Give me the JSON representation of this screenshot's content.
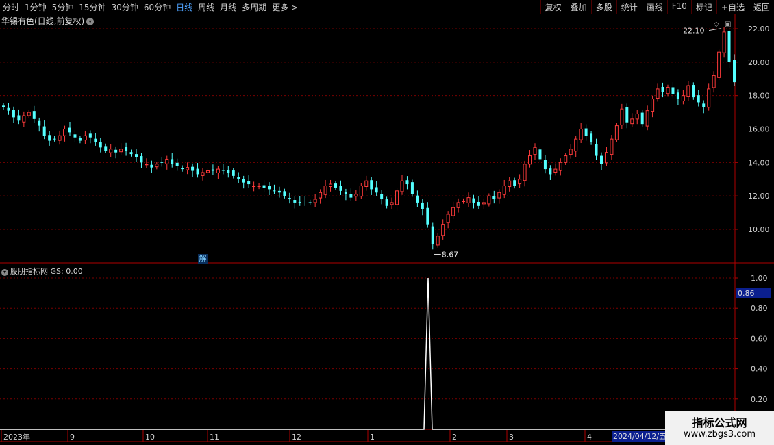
{
  "toolbar": {
    "periods": [
      "分时",
      "1分钟",
      "5分钟",
      "15分钟",
      "30分钟",
      "60分钟",
      "日线",
      "周线",
      "月线",
      "多周期",
      "更多 >"
    ],
    "active_period": "日线",
    "right_buttons": [
      "复权",
      "叠加",
      "多股",
      "统计",
      "画线",
      "F10",
      "标记",
      "+自选",
      "返回"
    ]
  },
  "main_chart": {
    "title": "华锡有色(日线,前复权)",
    "price_axis": [
      "22.00",
      "20.00",
      "18.00",
      "16.00",
      "14.00",
      "12.00",
      "10.00"
    ],
    "high_label": "22.10",
    "low_label": "8.67",
    "jie_badge": "解"
  },
  "indicator": {
    "title": "股朋指标网 GS: 0.00",
    "axis": [
      "1.00",
      "0.80",
      "0.60",
      "0.40",
      "0.20"
    ],
    "current_value": "0.86"
  },
  "x_axis": {
    "labels": [
      "2023年",
      "9",
      "10",
      "11",
      "12",
      "1",
      "2",
      "3",
      "4"
    ],
    "cursor_date": "2024/04/12/五"
  },
  "watermark": {
    "line1": "指标公式网",
    "line2": "www.zbgs3.com"
  },
  "colors": {
    "up": "#ff3b3b",
    "down": "#54ffff",
    "grid": "#7a0000",
    "axis_text": "#d0d0d0"
  },
  "chart_data": {
    "type": "candlestick",
    "x_labels": [
      "2023年",
      "9",
      "10",
      "11",
      "12",
      "1",
      "2",
      "3",
      "4"
    ],
    "y_range": [
      8.0,
      22.5
    ],
    "annotations": [
      {
        "label": "22.10",
        "value": 22.1
      },
      {
        "label": "8.67",
        "value": 8.67
      }
    ],
    "close_trajectory": [
      17.3,
      17.1,
      16.7,
      16.5,
      16.8,
      17.0,
      16.6,
      16.2,
      15.6,
      15.3,
      15.4,
      15.6,
      16.0,
      15.8,
      15.5,
      15.3,
      15.6,
      15.5,
      15.2,
      14.9,
      14.7,
      14.8,
      14.6,
      14.8,
      14.7,
      14.5,
      14.3,
      14.0,
      13.9,
      13.7,
      13.9,
      14.0,
      14.2,
      13.9,
      13.8,
      13.6,
      13.7,
      13.5,
      13.3,
      13.4,
      13.5,
      13.5,
      13.6,
      13.5,
      13.4,
      13.2,
      13.0,
      12.8,
      12.7,
      12.6,
      12.6,
      12.5,
      12.4,
      12.3,
      12.2,
      12.0,
      11.8,
      11.6,
      11.6,
      11.7,
      11.6,
      11.8,
      12.2,
      12.6,
      12.7,
      12.5,
      12.3,
      12.1,
      11.9,
      12.1,
      12.6,
      12.9,
      12.4,
      12.2,
      11.8,
      11.4,
      11.6,
      12.3,
      12.9,
      12.7,
      12.1,
      11.6,
      11.2,
      10.3,
      9.1,
      9.6,
      10.3,
      10.9,
      11.3,
      11.6,
      11.7,
      11.9,
      11.6,
      11.4,
      11.6,
      12.0,
      11.8,
      12.2,
      12.6,
      12.9,
      12.6,
      13.0,
      13.9,
      14.4,
      14.9,
      14.2,
      13.6,
      13.3,
      13.6,
      14.0,
      14.4,
      14.8,
      15.4,
      16.0,
      15.6,
      15.2,
      14.4,
      13.9,
      14.6,
      15.4,
      16.2,
      17.2,
      16.4,
      16.6,
      16.9,
      16.3,
      17.1,
      17.8,
      18.4,
      18.2,
      18.5,
      18.1,
      17.8,
      18.0,
      18.6,
      17.9,
      17.6,
      17.3,
      18.4,
      19.2,
      20.6,
      21.8,
      20.0,
      18.8
    ],
    "indicator_series": {
      "name": "GS",
      "peak_value": 1.0,
      "baseline": 0.0,
      "y_range": [
        0,
        1.05
      ]
    }
  }
}
